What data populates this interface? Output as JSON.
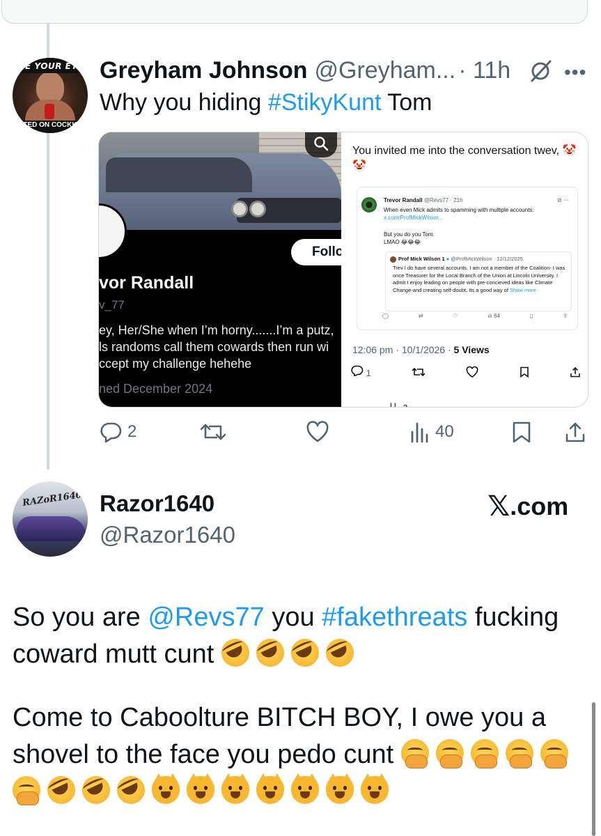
{
  "reply": {
    "display_name": "Greyham Johnson",
    "handle": "@Greyham...",
    "time": "· 11h",
    "avatar_top_text": "ME YOUR EYE",
    "avatar_bottom_text": "TED ON COCKK",
    "text_prefix": "Why you hiding ",
    "hashtag": "#StikyKunt",
    "text_suffix": " Tom",
    "media_left": {
      "follow_label": "Follo",
      "name": "vor Randall",
      "handle": "v_77",
      "bio": "ey, Her/She when I’m horny.......I’m a putz,\nls randoms call them cowards then run wi\nccept my challenge hehehe",
      "joined": "ned December 2024"
    },
    "media_right": {
      "text": "You invited me into the conversation twev, 🤡 🤡",
      "inner_name": "Trevor Randall",
      "inner_handle": "@Revs77 · 21h",
      "inner_text": "When even Mick admits to spamming with multiple accounts:",
      "inner_link": "x.com/ProfMickWilson...",
      "inner_text2_line1": "But you do you Tom.",
      "inner_text2_line2": "LMAO 😂😂😂",
      "qq_name": "Prof Mick Wilson 1",
      "qq_handle": "@ProfMickWilson · 12/12/2025",
      "qq_text": "Trev  I do have several accounts.  I am not a member of the Coalition- I was once  Treasurer for the Local Branch of the Union at Lincoln University. I admit I enjoy leading on people with pre-concieved ideas like Climate Change-and creating self-doubt. Its a good way of ",
      "qq_show": "Show more",
      "inner_views": "64",
      "meta_time": "12:06 pm · 10/1/2026 · ",
      "meta_views": "5 Views",
      "replies": "1",
      "cut_text": "ll a"
    },
    "stats": {
      "replies": "2",
      "views": "40"
    }
  },
  "embed": {
    "display_name": "Razor1640",
    "handle": "@Razor1640",
    "avatar_text": "RAZoR1640",
    "site_logo": "𝕏",
    "site_suffix": ".com",
    "para1_a": "So you are ",
    "mention": "@Revs77",
    "para1_b": " you ",
    "hashtag": "#fakethreats",
    "para1_c": " fucking coward mutt cunt ",
    "para2": "Come to Caboolture BITCH BOY, I owe you a shovel to the face you pedo cunt "
  },
  "colors": {
    "link": "#1d9bf0",
    "text": "#0f1419",
    "muted": "#536471",
    "border": "#cfd9de"
  }
}
